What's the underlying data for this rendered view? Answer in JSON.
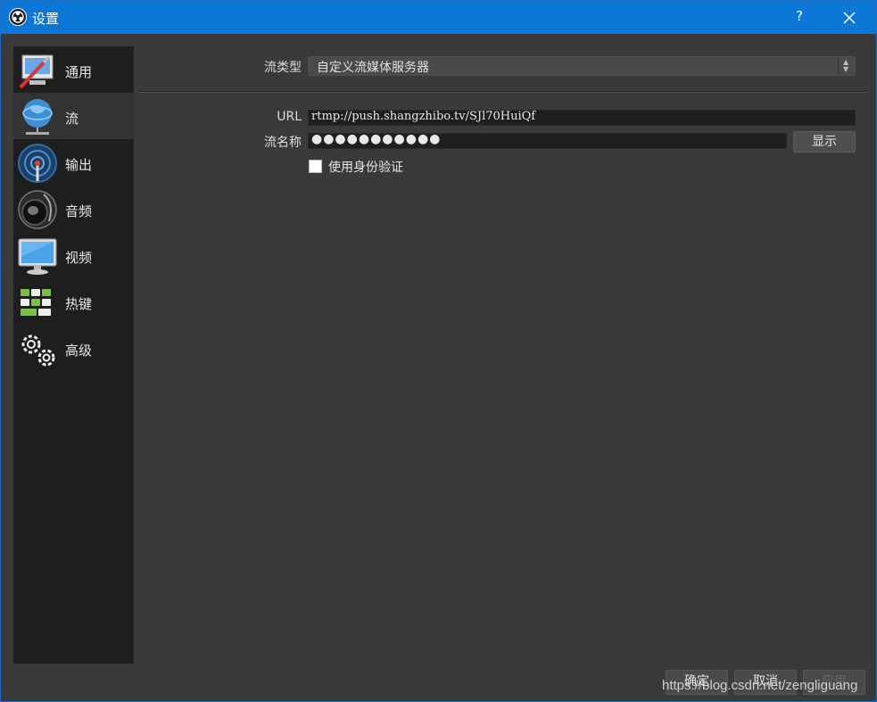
{
  "window": {
    "title": "设置",
    "help_label": "?",
    "accent_color": "#0b78d7"
  },
  "sidebar": {
    "items": [
      {
        "label": "通用",
        "icon": "general-settings-icon",
        "active": false
      },
      {
        "label": "流",
        "icon": "globe-network-icon",
        "active": true
      },
      {
        "label": "输出",
        "icon": "broadcast-antenna-icon",
        "active": false
      },
      {
        "label": "音频",
        "icon": "speaker-icon",
        "active": false
      },
      {
        "label": "视频",
        "icon": "monitor-icon",
        "active": false
      },
      {
        "label": "热键",
        "icon": "keyboard-icon",
        "active": false
      },
      {
        "label": "高级",
        "icon": "gears-icon",
        "active": false
      }
    ]
  },
  "stream": {
    "type_label": "流类型",
    "type_value": "自定义流媒体服务器",
    "url_label": "URL",
    "url_value": "rtmp://push.shangzhibo.tv/SJl70HuiQf",
    "key_label": "流名称",
    "key_masked": "●●●●●●●●●●●",
    "show_button": "显示",
    "auth_checkbox_label": "使用身份验证",
    "auth_checked": false
  },
  "footer": {
    "ok": "确定",
    "cancel": "取消",
    "apply": "应用"
  },
  "watermark": "https://blog.csdn.net/zengliguang"
}
